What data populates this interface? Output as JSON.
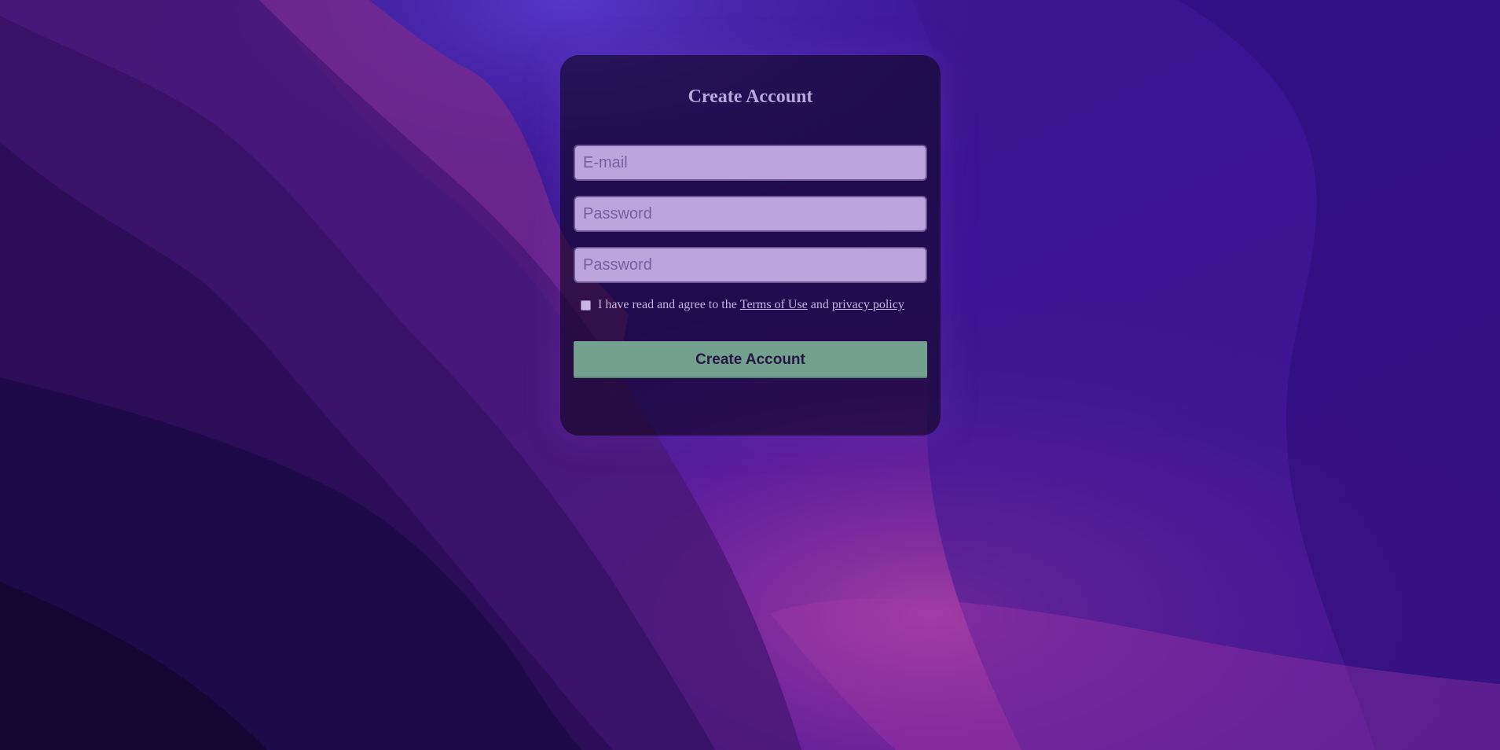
{
  "form": {
    "title": "Create Account",
    "email_placeholder": "E-mail",
    "password_placeholder": "Password",
    "confirm_password_placeholder": "Password",
    "agree_prefix": "I have read and agree to the",
    "terms_link": "Terms of Use",
    "agree_and": "and",
    "privacy_link": "privacy policy",
    "agree_checked": false,
    "submit_label": "Create Account"
  },
  "colors": {
    "card_background": "#1a0a30",
    "input_background": "#bba5dc",
    "submit_background": "#73a08f",
    "title_color": "#b9a6da"
  }
}
